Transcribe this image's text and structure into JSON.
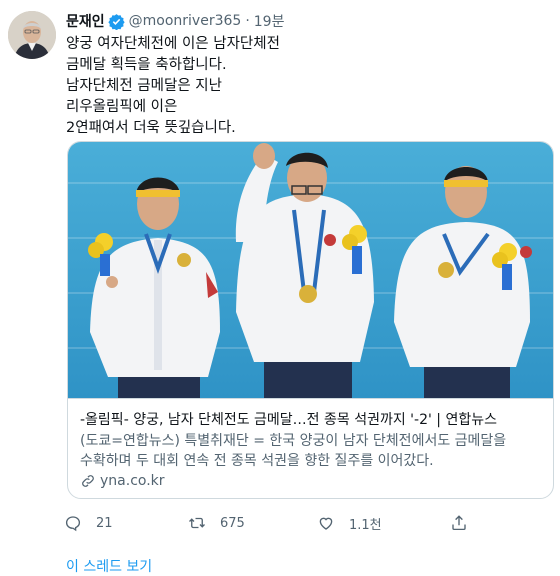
{
  "tweet": {
    "author_name": "문재인",
    "handle": "@moonriver365",
    "separator": "·",
    "time": "19분",
    "lines": [
      "양궁 여자단체전에 이은 남자단체전",
      "금메달 획득을 축하합니다.",
      "남자단체전 금메달은 지난",
      "리우올림픽에 이은",
      "2연패여서 더욱 뜻깊습니다."
    ]
  },
  "card": {
    "title": "-올림픽- 양궁, 남자 단체전도 금메달…전 종목 석권까지 '-2' | 연합뉴스",
    "description_lines": [
      "(도쿄=연합뉴스) 특별취재단 = 한국 양궁이 남자 단체전에서도 금메달을",
      "수확하며 두 대회 연속 전 종목 석권을 향한 질주를 이어갔다."
    ],
    "domain": "yna.co.kr"
  },
  "actions": {
    "reply_count": "21",
    "retweet_count": "675",
    "like_count": "1.1천"
  },
  "thread_link": "이 스레드 보기",
  "colors": {
    "accent": "#1d9bf0",
    "secondary_text": "#536471",
    "border": "#cfd9de"
  }
}
